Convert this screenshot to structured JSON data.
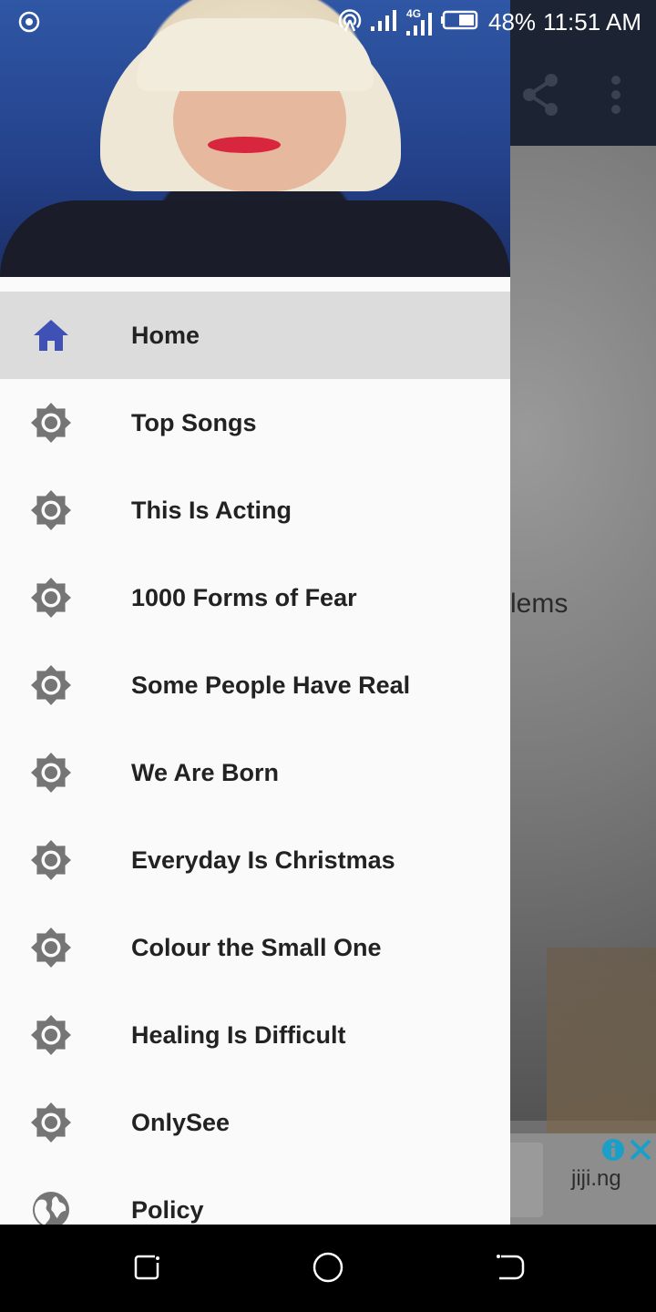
{
  "status_bar": {
    "battery": "48%",
    "time": "11:51 AM",
    "network": "4G",
    "icons": [
      "focus-icon",
      "hotspot-icon",
      "signal-icon",
      "signal-4g-icon",
      "battery-icon"
    ]
  },
  "background": {
    "partial_title": "lems",
    "actions": [
      "share-icon",
      "more-vert-icon"
    ],
    "ad": {
      "text": "jiji.ng",
      "icons": [
        "info-icon",
        "close-icon"
      ]
    }
  },
  "drawer": {
    "header_image": "artist-photo",
    "items": [
      {
        "label": "Home",
        "icon": "home-icon",
        "active": true
      },
      {
        "label": "Top Songs",
        "icon": "brightness-icon"
      },
      {
        "label": "This Is Acting",
        "icon": "brightness-icon"
      },
      {
        "label": "1000 Forms of Fear",
        "icon": "brightness-icon"
      },
      {
        "label": "Some People Have Real",
        "icon": "brightness-icon"
      },
      {
        "label": "We Are Born",
        "icon": "brightness-icon"
      },
      {
        "label": "Everyday Is Christmas",
        "icon": "brightness-icon"
      },
      {
        "label": "Colour the Small One",
        "icon": "brightness-icon"
      },
      {
        "label": "Healing Is Difficult",
        "icon": "brightness-icon"
      },
      {
        "label": "OnlySee",
        "icon": "brightness-icon"
      },
      {
        "label": "Policy",
        "icon": "globe-icon"
      }
    ]
  },
  "colors": {
    "accent": "#3f51b5",
    "drawer_bg": "#fafafa",
    "active_row": "#dcdcdc",
    "icon_gray": "#757575"
  },
  "nav_bar": [
    "recent-apps-icon",
    "home-circle-icon",
    "back-icon"
  ]
}
